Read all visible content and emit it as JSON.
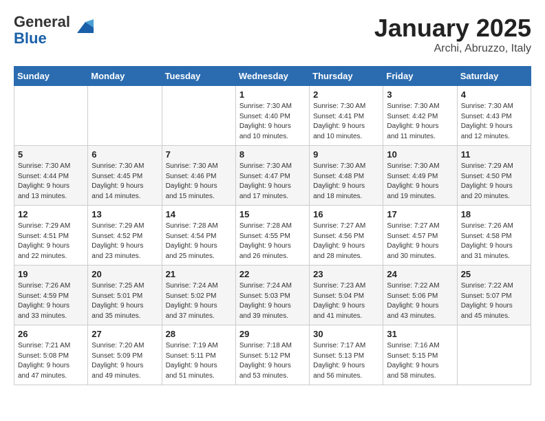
{
  "logo": {
    "general": "General",
    "blue": "Blue"
  },
  "header": {
    "month": "January 2025",
    "location": "Archi, Abruzzo, Italy"
  },
  "weekdays": [
    "Sunday",
    "Monday",
    "Tuesday",
    "Wednesday",
    "Thursday",
    "Friday",
    "Saturday"
  ],
  "weeks": [
    [
      {
        "day": "",
        "info": ""
      },
      {
        "day": "",
        "info": ""
      },
      {
        "day": "",
        "info": ""
      },
      {
        "day": "1",
        "info": "Sunrise: 7:30 AM\nSunset: 4:40 PM\nDaylight: 9 hours\nand 10 minutes."
      },
      {
        "day": "2",
        "info": "Sunrise: 7:30 AM\nSunset: 4:41 PM\nDaylight: 9 hours\nand 10 minutes."
      },
      {
        "day": "3",
        "info": "Sunrise: 7:30 AM\nSunset: 4:42 PM\nDaylight: 9 hours\nand 11 minutes."
      },
      {
        "day": "4",
        "info": "Sunrise: 7:30 AM\nSunset: 4:43 PM\nDaylight: 9 hours\nand 12 minutes."
      }
    ],
    [
      {
        "day": "5",
        "info": "Sunrise: 7:30 AM\nSunset: 4:44 PM\nDaylight: 9 hours\nand 13 minutes."
      },
      {
        "day": "6",
        "info": "Sunrise: 7:30 AM\nSunset: 4:45 PM\nDaylight: 9 hours\nand 14 minutes."
      },
      {
        "day": "7",
        "info": "Sunrise: 7:30 AM\nSunset: 4:46 PM\nDaylight: 9 hours\nand 15 minutes."
      },
      {
        "day": "8",
        "info": "Sunrise: 7:30 AM\nSunset: 4:47 PM\nDaylight: 9 hours\nand 17 minutes."
      },
      {
        "day": "9",
        "info": "Sunrise: 7:30 AM\nSunset: 4:48 PM\nDaylight: 9 hours\nand 18 minutes."
      },
      {
        "day": "10",
        "info": "Sunrise: 7:30 AM\nSunset: 4:49 PM\nDaylight: 9 hours\nand 19 minutes."
      },
      {
        "day": "11",
        "info": "Sunrise: 7:29 AM\nSunset: 4:50 PM\nDaylight: 9 hours\nand 20 minutes."
      }
    ],
    [
      {
        "day": "12",
        "info": "Sunrise: 7:29 AM\nSunset: 4:51 PM\nDaylight: 9 hours\nand 22 minutes."
      },
      {
        "day": "13",
        "info": "Sunrise: 7:29 AM\nSunset: 4:52 PM\nDaylight: 9 hours\nand 23 minutes."
      },
      {
        "day": "14",
        "info": "Sunrise: 7:28 AM\nSunset: 4:54 PM\nDaylight: 9 hours\nand 25 minutes."
      },
      {
        "day": "15",
        "info": "Sunrise: 7:28 AM\nSunset: 4:55 PM\nDaylight: 9 hours\nand 26 minutes."
      },
      {
        "day": "16",
        "info": "Sunrise: 7:27 AM\nSunset: 4:56 PM\nDaylight: 9 hours\nand 28 minutes."
      },
      {
        "day": "17",
        "info": "Sunrise: 7:27 AM\nSunset: 4:57 PM\nDaylight: 9 hours\nand 30 minutes."
      },
      {
        "day": "18",
        "info": "Sunrise: 7:26 AM\nSunset: 4:58 PM\nDaylight: 9 hours\nand 31 minutes."
      }
    ],
    [
      {
        "day": "19",
        "info": "Sunrise: 7:26 AM\nSunset: 4:59 PM\nDaylight: 9 hours\nand 33 minutes."
      },
      {
        "day": "20",
        "info": "Sunrise: 7:25 AM\nSunset: 5:01 PM\nDaylight: 9 hours\nand 35 minutes."
      },
      {
        "day": "21",
        "info": "Sunrise: 7:24 AM\nSunset: 5:02 PM\nDaylight: 9 hours\nand 37 minutes."
      },
      {
        "day": "22",
        "info": "Sunrise: 7:24 AM\nSunset: 5:03 PM\nDaylight: 9 hours\nand 39 minutes."
      },
      {
        "day": "23",
        "info": "Sunrise: 7:23 AM\nSunset: 5:04 PM\nDaylight: 9 hours\nand 41 minutes."
      },
      {
        "day": "24",
        "info": "Sunrise: 7:22 AM\nSunset: 5:06 PM\nDaylight: 9 hours\nand 43 minutes."
      },
      {
        "day": "25",
        "info": "Sunrise: 7:22 AM\nSunset: 5:07 PM\nDaylight: 9 hours\nand 45 minutes."
      }
    ],
    [
      {
        "day": "26",
        "info": "Sunrise: 7:21 AM\nSunset: 5:08 PM\nDaylight: 9 hours\nand 47 minutes."
      },
      {
        "day": "27",
        "info": "Sunrise: 7:20 AM\nSunset: 5:09 PM\nDaylight: 9 hours\nand 49 minutes."
      },
      {
        "day": "28",
        "info": "Sunrise: 7:19 AM\nSunset: 5:11 PM\nDaylight: 9 hours\nand 51 minutes."
      },
      {
        "day": "29",
        "info": "Sunrise: 7:18 AM\nSunset: 5:12 PM\nDaylight: 9 hours\nand 53 minutes."
      },
      {
        "day": "30",
        "info": "Sunrise: 7:17 AM\nSunset: 5:13 PM\nDaylight: 9 hours\nand 56 minutes."
      },
      {
        "day": "31",
        "info": "Sunrise: 7:16 AM\nSunset: 5:15 PM\nDaylight: 9 hours\nand 58 minutes."
      },
      {
        "day": "",
        "info": ""
      }
    ]
  ]
}
